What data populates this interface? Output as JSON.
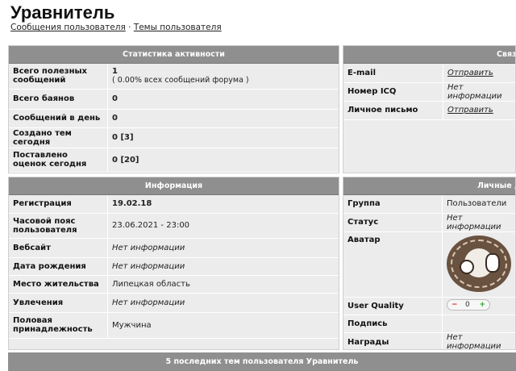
{
  "profile": {
    "name": "Уравнитель",
    "links": {
      "messages": "Сообщения пользователя",
      "separator": "·",
      "topics": "Темы пользователя"
    }
  },
  "stats": {
    "header": "Статистика активности",
    "rows": [
      {
        "label": "Всего полезных сообщений",
        "value": "1",
        "sub": "( 0.00% всех сообщений форума )"
      },
      {
        "label": "Всего баянов",
        "value": "0"
      },
      {
        "label": "Сообщений в день",
        "value": "0"
      },
      {
        "label": "Создано тем сегодня",
        "value": "0 [3]"
      },
      {
        "label": "Поставлено оценок сегодня",
        "value": "0 [20]"
      }
    ]
  },
  "contacts": {
    "header": "Связь",
    "rows": [
      {
        "label": "E-mail",
        "value": "Отправить"
      },
      {
        "label": "Номер ICQ",
        "value": "Нет информации"
      },
      {
        "label": "Личное письмо",
        "value": "Отправить"
      }
    ]
  },
  "info": {
    "header": "Информация",
    "rows": [
      {
        "label": "Регистрация",
        "value": "19.02.18"
      },
      {
        "label": "Часовой пояс пользователя",
        "value": "23.06.2021 - 23:00"
      },
      {
        "label": "Вебсайт",
        "value": "Нет информации"
      },
      {
        "label": "Дата рождения",
        "value": "Нет информации"
      },
      {
        "label": "Место жительства",
        "value": "Липецкая область"
      },
      {
        "label": "Увлечения",
        "value": "Нет информации"
      },
      {
        "label": "Половая принадлежность",
        "value": "Мужчина"
      }
    ]
  },
  "personal": {
    "header": "Личные данные",
    "rows": [
      {
        "label": "Группа",
        "value": "Пользователи"
      },
      {
        "label": "Статус",
        "value": "Нет информации"
      },
      {
        "label": "Аватар",
        "value": ""
      },
      {
        "label": "User Quality",
        "minus": "−",
        "value": "0",
        "plus": "+"
      },
      {
        "label": "Подпись",
        "value": ""
      },
      {
        "label": "Награды",
        "value": "Нет информации"
      }
    ]
  },
  "footer": {
    "text": "5 последних тем пользователя Уравнитель"
  }
}
